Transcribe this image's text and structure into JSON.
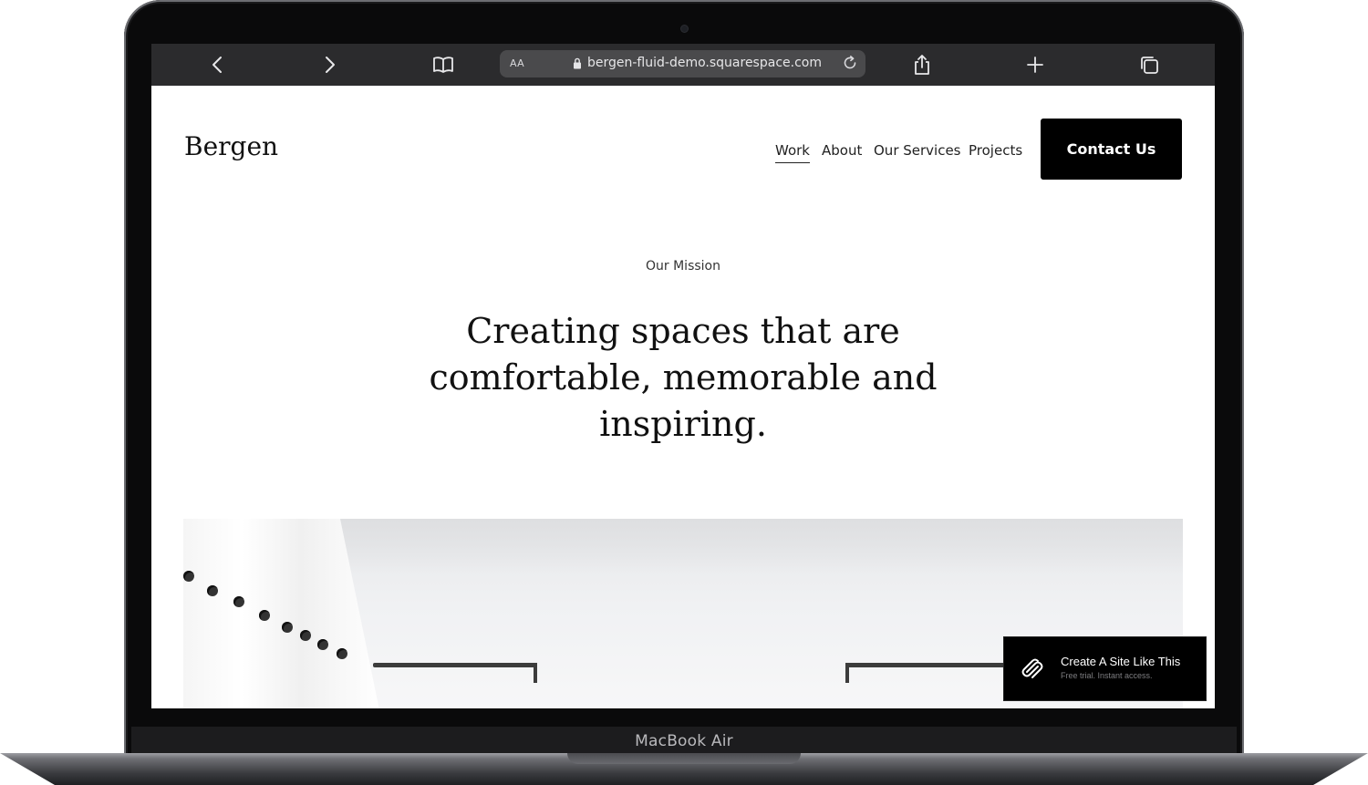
{
  "device": {
    "label": "MacBook Air"
  },
  "browser": {
    "text_size_label": "AA",
    "url": "bergen-fluid-demo.squarespace.com",
    "icons": [
      "back-icon",
      "forward-icon",
      "bookmarks-icon",
      "lock-icon",
      "reload-icon",
      "share-icon",
      "new-tab-icon",
      "tabs-icon"
    ]
  },
  "site": {
    "logo": "Bergen",
    "nav": [
      {
        "label": "Work",
        "active": true
      },
      {
        "label": "About"
      },
      {
        "label": "Our Services"
      },
      {
        "label": "Projects"
      }
    ],
    "cta": "Contact Us",
    "mission_label": "Our Mission",
    "headline_lines": [
      "Creating spaces that are",
      "comfortable, memorable and",
      "inspiring."
    ]
  },
  "badge": {
    "title": "Create A Site Like This",
    "subtitle": "Free trial. Instant access."
  },
  "colors": {
    "toolbar": "#2b2b2d",
    "address_bar": "#4a4a4c",
    "cta": "#000000",
    "page": "#ffffff"
  }
}
